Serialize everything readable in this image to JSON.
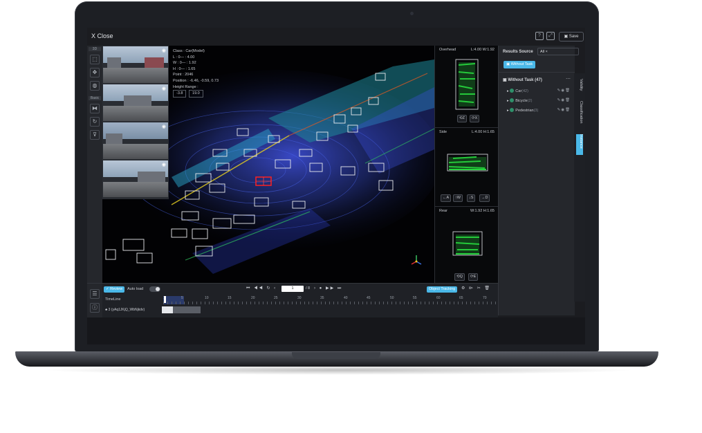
{
  "topbar": {
    "close_label": "X Close",
    "save_label": "Save"
  },
  "toolbar": {
    "group_3d": "3D",
    "group_basic": "Basic"
  },
  "viewport": {
    "info_lines": [
      "Class : Car(Model)",
      "L : 0— : 4.00",
      "W : 0— : 1.92",
      "H : 0— : 1.65",
      "Point : 2046",
      "Position : -6.46, -0.59, 0.73",
      "Height Range :"
    ],
    "height_min": "-3.8",
    "height_max": "19.0"
  },
  "side_views": {
    "overhead": {
      "title": "Overhead",
      "dims": "L:4.00 W:1.92"
    },
    "side": {
      "title": "Side",
      "dims": "L:4.00 H:1.65"
    },
    "rear": {
      "title": "Rear",
      "dims": "W:1.92 H:1.65"
    },
    "buttons": {
      "z": "Z",
      "x": "X",
      "a": "A",
      "w": "W",
      "s": "S",
      "d": "D",
      "q": "Q",
      "e": "E"
    }
  },
  "results": {
    "title": "Results Source",
    "filter": "All",
    "without_task_button": "Without Task",
    "group_label": "Without Task (47)",
    "items": [
      {
        "name": "Car",
        "count": "(42)"
      },
      {
        "name": "Bicycle",
        "count": "(2)"
      },
      {
        "name": "Pedestrian",
        "count": "(3)"
      }
    ],
    "tabs": [
      "Validity",
      "Classification",
      "Instance"
    ]
  },
  "timeline": {
    "review_label": "Review",
    "autoload_label": "Auto load",
    "current_frame": "1",
    "total_frames": "/ 8",
    "object_tracking_label": "Object Tracking",
    "label": "TimeLine",
    "ticks": [
      "1",
      "5",
      "10",
      "15",
      "20",
      "25",
      "30",
      "35",
      "40",
      "45",
      "50",
      "55",
      "60",
      "65",
      "70"
    ],
    "track_label": "3 (yAq1JKjQ_WbNjkdv)"
  },
  "colors": {
    "accent": "#4ab8e8",
    "selected_box": "#ff2020",
    "panel_bg": "#25272c"
  }
}
